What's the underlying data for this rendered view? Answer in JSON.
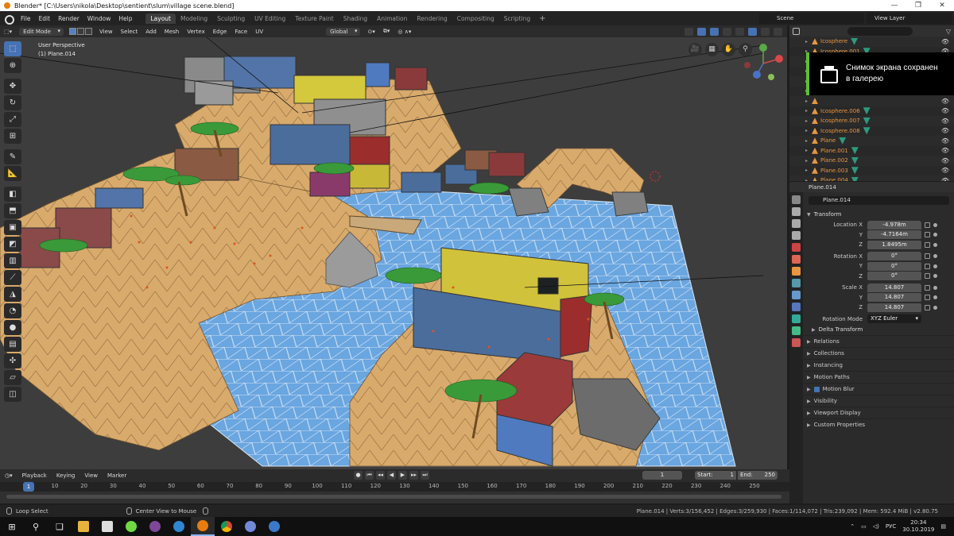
{
  "window": {
    "title": "Blender* [C:\\Users\\nikola\\Desktop\\sentient\\slum\\village scene.blend]",
    "controls": [
      "—",
      "❐",
      "✕"
    ]
  },
  "menubar": {
    "menus": [
      "File",
      "Edit",
      "Render",
      "Window",
      "Help"
    ],
    "workspaces": [
      "Layout",
      "Modeling",
      "Sculpting",
      "UV Editing",
      "Texture Paint",
      "Shading",
      "Animation",
      "Rendering",
      "Compositing",
      "Scripting"
    ],
    "active_workspace": "Layout",
    "add_workspace": "+",
    "scene": "Scene",
    "view_layer": "View Layer"
  },
  "viewport_header": {
    "mode": "Edit Mode",
    "menus": [
      "View",
      "Select",
      "Add",
      "Mesh",
      "Vertex",
      "Edge",
      "Face",
      "UV"
    ],
    "transform_orientation": "Global"
  },
  "viewport": {
    "view_name": "User Perspective",
    "object_label": "(1) Plane.014"
  },
  "toolbar": {
    "tools": [
      {
        "name": "select-box-tool",
        "glyph": "⬚",
        "active": true
      },
      {
        "name": "cursor-tool",
        "glyph": "⊕"
      },
      {
        "name": "move-tool",
        "glyph": "✥"
      },
      {
        "name": "rotate-tool",
        "glyph": "↻"
      },
      {
        "name": "scale-tool",
        "glyph": "⤢"
      },
      {
        "name": "transform-tool",
        "glyph": "⊞"
      },
      {
        "name": "annotate-tool",
        "glyph": "✎"
      },
      {
        "name": "measure-tool",
        "glyph": "📐"
      },
      {
        "name": "add-cube-tool",
        "glyph": "◧"
      },
      {
        "name": "extrude-tool",
        "glyph": "⬒"
      },
      {
        "name": "inset-tool",
        "glyph": "▣"
      },
      {
        "name": "bevel-tool",
        "glyph": "◩"
      },
      {
        "name": "loop-cut-tool",
        "glyph": "▥"
      },
      {
        "name": "knife-tool",
        "glyph": "⟋"
      },
      {
        "name": "poly-build-tool",
        "glyph": "◮"
      },
      {
        "name": "spin-tool",
        "glyph": "◔"
      },
      {
        "name": "smooth-tool",
        "glyph": "●"
      },
      {
        "name": "edge-slide-tool",
        "glyph": "▤"
      },
      {
        "name": "shrink-fatten-tool",
        "glyph": "✣"
      },
      {
        "name": "shear-tool",
        "glyph": "▱"
      },
      {
        "name": "rip-region-tool",
        "glyph": "◫"
      }
    ]
  },
  "outliner": {
    "items": [
      {
        "name": "Icosphere",
        "modifier": true
      },
      {
        "name": "Icosphere.001",
        "modifier": true
      },
      {
        "name": "",
        "modifier": false
      },
      {
        "name": "",
        "modifier": false
      },
      {
        "name": "",
        "modifier": false
      },
      {
        "name": "",
        "modifier": false
      },
      {
        "name": "",
        "modifier": false
      },
      {
        "name": "Icosphere.006",
        "modifier": true
      },
      {
        "name": "Icosphere.007",
        "modifier": true
      },
      {
        "name": "Icosphere.008",
        "modifier": true
      },
      {
        "name": "Plane",
        "modifier": true
      },
      {
        "name": "Plane.001",
        "modifier": true
      },
      {
        "name": "Plane.002",
        "modifier": true
      },
      {
        "name": "Plane.003",
        "modifier": true
      },
      {
        "name": "Plane.004",
        "modifier": true
      },
      {
        "name": "Plane.005",
        "modifier": true
      }
    ]
  },
  "toast": {
    "message": "Снимок экрана сохранен в галерею"
  },
  "properties": {
    "header_object": "Plane.014",
    "object_name": "Plane.014",
    "transform_title": "Transform",
    "location": {
      "label_x": "Location X",
      "x": "-4.978m",
      "y": "-4.7164m",
      "z": "1.8495m"
    },
    "rotation": {
      "label_x": "Rotation X",
      "x": "0°",
      "y": "0°",
      "z": "0°"
    },
    "scale": {
      "label_x": "Scale X",
      "x": "14.807",
      "y": "14.807",
      "z": "14.807"
    },
    "axis_y": "Y",
    "axis_z": "Z",
    "rotation_mode_label": "Rotation Mode",
    "rotation_mode": "XYZ Euler",
    "delta_transform": "Delta Transform",
    "panels": [
      "Relations",
      "Collections",
      "Instancing",
      "Motion Paths",
      "Motion Blur",
      "Visibility",
      "Viewport Display",
      "Custom Properties"
    ]
  },
  "timeline": {
    "menus": [
      "Playback",
      "Keying",
      "View",
      "Marker"
    ],
    "current_frame": "1",
    "start_label": "Start:",
    "start": "1",
    "end_label": "End:",
    "end": "250",
    "ticks": [
      "1",
      "10",
      "20",
      "30",
      "40",
      "50",
      "60",
      "70",
      "80",
      "90",
      "100",
      "110",
      "120",
      "130",
      "140",
      "150",
      "160",
      "170",
      "180",
      "190",
      "200",
      "210",
      "220",
      "230",
      "240",
      "250"
    ]
  },
  "statusbar": {
    "left_action": "Loop Select",
    "middle_action": "Center View to Mouse",
    "stats": "Plane.014 | Verts:3/156,452 | Edges:3/259,930 | Faces:1/114,072 | Tris:239,092 | Mem: 592.4 MiB | v2.80.75"
  },
  "taskbar": {
    "time": "20:34",
    "date": "30.10.2019",
    "language": "РУС"
  },
  "colors": {
    "blender_orange": "#e87d0d",
    "accent_blue": "#4772b3",
    "toast_green": "#5fbf2a",
    "object_orange": "#e8963f"
  }
}
